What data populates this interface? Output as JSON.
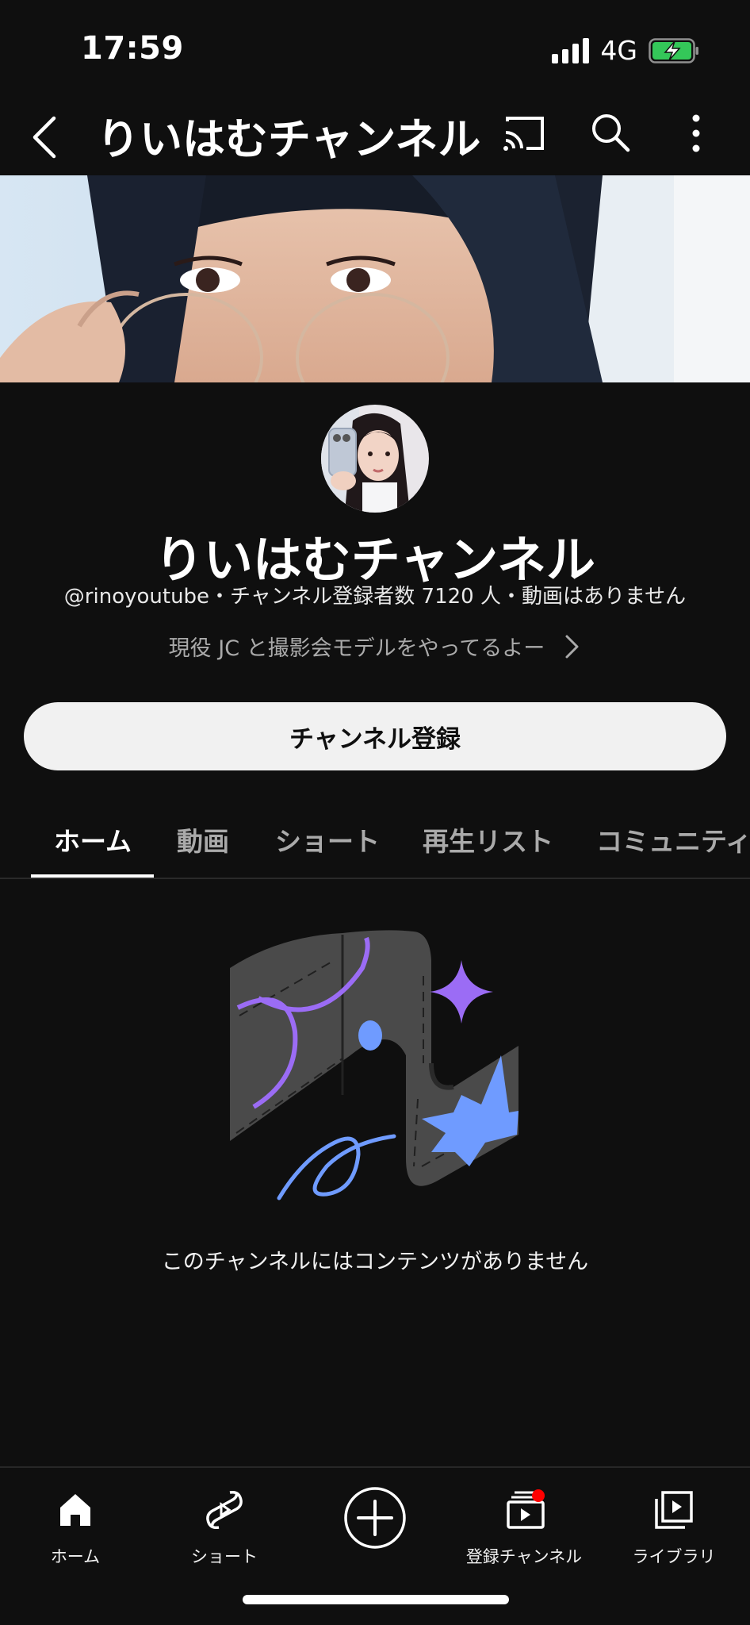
{
  "status_bar": {
    "time": "17:59",
    "network": "4G"
  },
  "top_bar": {
    "title": "りいはむチャンネル"
  },
  "channel": {
    "name": "りいはむチャンネル",
    "meta": "@rinoyoutube・チャンネル登録者数 7120 人・動画はありません",
    "description": "現役 JC と撮影会モデルをやってるよー",
    "subscribe_label": "チャンネル登録"
  },
  "tabs": [
    {
      "label": "ホーム",
      "active": true
    },
    {
      "label": "動画",
      "active": false
    },
    {
      "label": "ショート",
      "active": false
    },
    {
      "label": "再生リスト",
      "active": false
    },
    {
      "label": "コミュニティ",
      "active": false
    }
  ],
  "empty_state": {
    "message": "このチャンネルにはコンテンツがありません"
  },
  "bottom_nav": [
    {
      "label": "ホーム",
      "icon": "home-icon"
    },
    {
      "label": "ショート",
      "icon": "shorts-icon"
    },
    {
      "label": "",
      "icon": "create-icon"
    },
    {
      "label": "登録チャンネル",
      "icon": "subscriptions-icon"
    },
    {
      "label": "ライブラリ",
      "icon": "library-icon"
    }
  ],
  "colors": {
    "background": "#0f0f0f",
    "accent_purple": "#9b6cf5",
    "accent_blue": "#6f9bff",
    "badge_red": "#ff0000",
    "battery_green": "#34c759"
  }
}
